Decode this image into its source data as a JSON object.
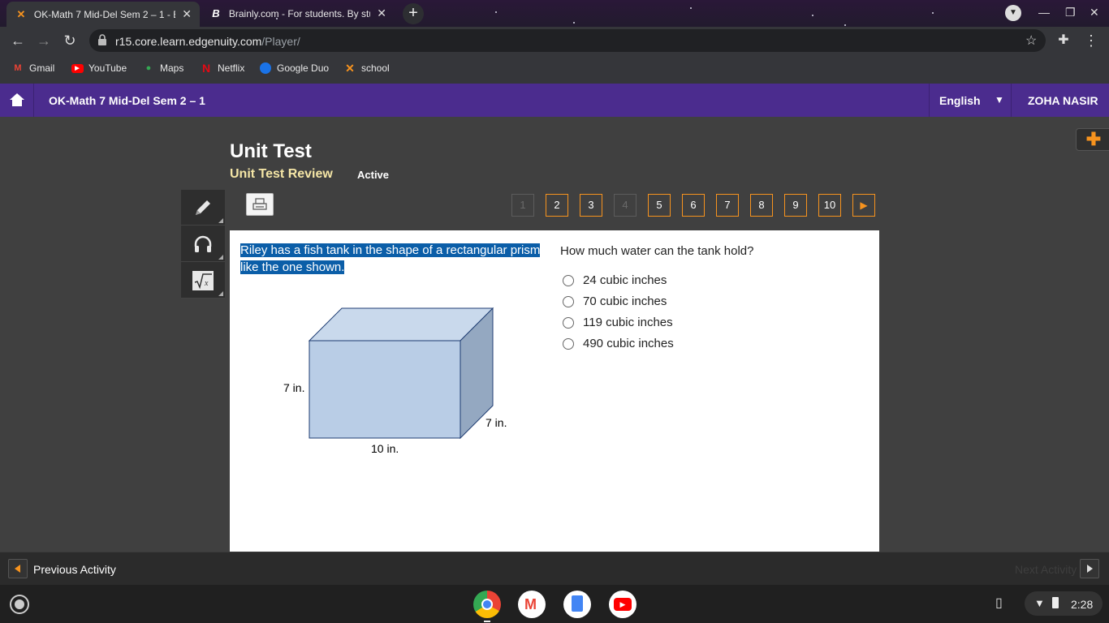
{
  "browser": {
    "tabs": [
      {
        "title": "OK-Math 7 Mid-Del Sem 2 – 1 - Edgenuity",
        "active": true,
        "favicon": "edgenuity-logo-icon"
      },
      {
        "title": "Brainly.com - For students. By students.",
        "active": false,
        "favicon": "brainly-logo-icon"
      }
    ],
    "url_host": "r15.core.learn.edgenuity.com",
    "url_path": "/Player/",
    "bookmarks": [
      {
        "label": "Gmail",
        "icon": "gmail-icon"
      },
      {
        "label": "YouTube",
        "icon": "youtube-icon"
      },
      {
        "label": "Maps",
        "icon": "maps-icon"
      },
      {
        "label": "Netflix",
        "icon": "netflix-icon"
      },
      {
        "label": "Google Duo",
        "icon": "duo-icon"
      },
      {
        "label": "school",
        "icon": "edgenuity-logo-icon"
      }
    ]
  },
  "header": {
    "course_title": "OK-Math 7 Mid-Del Sem 2 – 1",
    "language": "English",
    "user_name": "ZOHA NASIR",
    "accent": "#4b2c8e"
  },
  "activity": {
    "title": "Unit Test",
    "subtitle": "Unit Test Review",
    "status": "Active"
  },
  "pager": {
    "pages": [
      {
        "label": "1",
        "disabled": true
      },
      {
        "label": "2",
        "disabled": false
      },
      {
        "label": "3",
        "disabled": false
      },
      {
        "label": "4",
        "disabled": true
      },
      {
        "label": "5",
        "disabled": false
      },
      {
        "label": "6",
        "disabled": false
      },
      {
        "label": "7",
        "disabled": false
      },
      {
        "label": "8",
        "disabled": false
      },
      {
        "label": "9",
        "disabled": false
      },
      {
        "label": "10",
        "disabled": false
      }
    ],
    "accent": "#f7931e"
  },
  "question": {
    "stem": "Riley has a fish tank in the shape of a rectangular prism like the one shown.",
    "prompt": "How much water can the tank hold?",
    "figure": {
      "height_label": "7 in.",
      "depth_label": "7 in.",
      "width_label": "10 in."
    },
    "choices": [
      "24 cubic inches",
      "70 cubic inches",
      "119 cubic inches",
      "490 cubic inches"
    ]
  },
  "footer": {
    "previous_label": "Previous Activity",
    "next_label": "Next Activity"
  },
  "system": {
    "clock": "2:28"
  }
}
